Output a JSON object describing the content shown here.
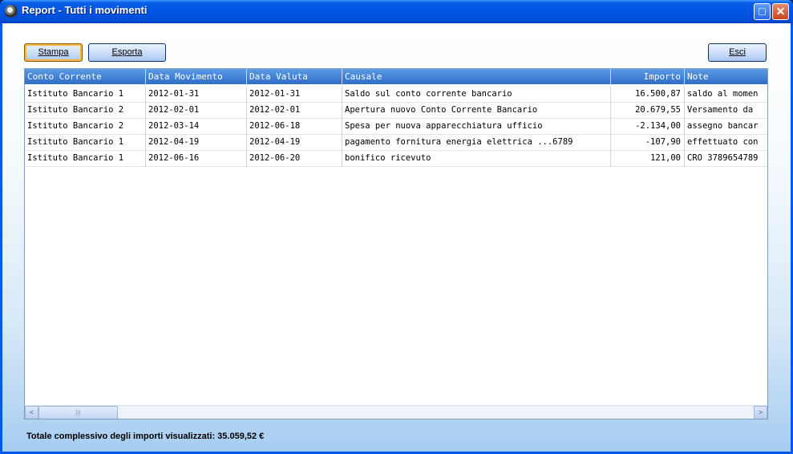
{
  "window": {
    "title": "Report - Tutti i movimenti"
  },
  "toolbar": {
    "print_label": "Stampa",
    "export_label": "Esporta",
    "exit_label": "Esci"
  },
  "table": {
    "columns": [
      "Conto Corrente",
      "Data Movimento",
      "Data Valuta",
      "Causale",
      "Importo",
      "Note"
    ],
    "rows": [
      [
        "Istituto Bancario 1",
        "2012-01-31",
        "2012-01-31",
        "Saldo sul conto corrente bancario",
        "16.500,87",
        "saldo al momen"
      ],
      [
        "Istituto Bancario 2",
        "2012-02-01",
        "2012-02-01",
        "Apertura nuovo Conto Corrente Bancario",
        "20.679,55",
        "Versamento da"
      ],
      [
        "Istituto Bancario 2",
        "2012-03-14",
        "2012-06-18",
        "Spesa per nuova apparecchiatura ufficio",
        "-2.134,00",
        "assegno bancar"
      ],
      [
        "Istituto Bancario 1",
        "2012-04-19",
        "2012-04-19",
        "pagamento fornitura energia elettrica ...6789",
        "-107,90",
        "effettuato con"
      ],
      [
        "Istituto Bancario 1",
        "2012-06-16",
        "2012-06-20",
        "bonifico ricevuto",
        "121,00",
        "CRO 3789654789"
      ]
    ]
  },
  "scrollbar": {
    "left_arrow": "<",
    "right_arrow": ">",
    "thumb_grip": "|||"
  },
  "footer": {
    "total_text": "Totale complessivo degli importi visualizzati: 35.059,52 €"
  },
  "icons": {
    "app": "gear-disc-icon",
    "maximize": "maximize-icon",
    "close": "close-icon"
  },
  "colors": {
    "titlebar": "#0054e3",
    "header": "#3b78d0",
    "accent_focus": "#f4b343"
  }
}
